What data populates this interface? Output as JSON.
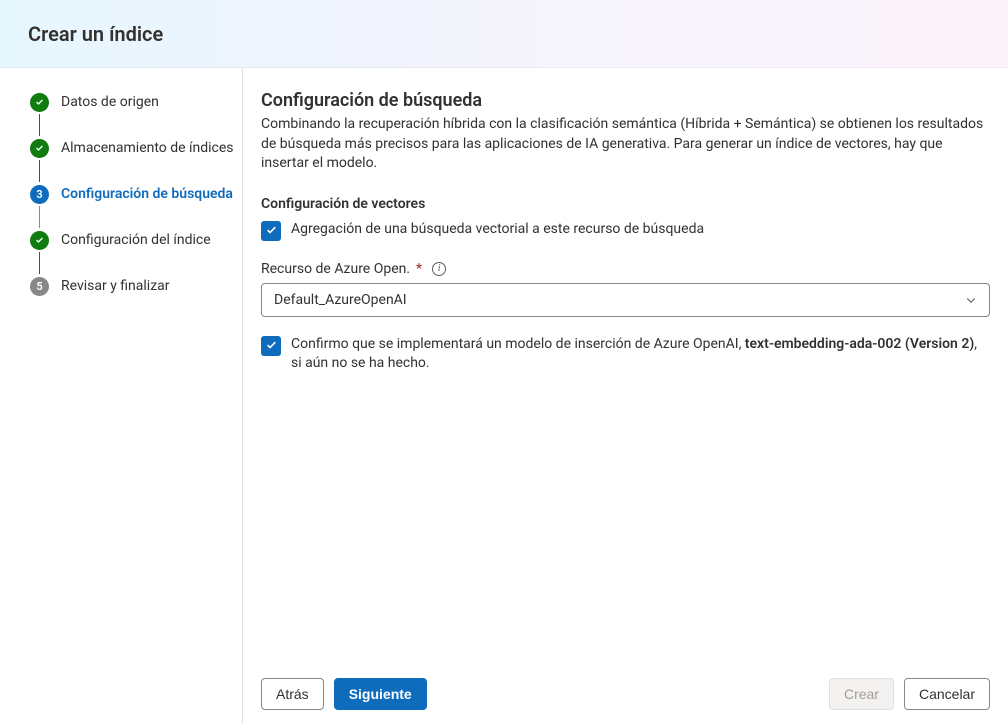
{
  "header": {
    "title": "Crear un índice"
  },
  "sidebar": {
    "steps": [
      {
        "label": "Datos de origen",
        "state": "done"
      },
      {
        "label": "Almacenamiento de índices",
        "state": "done"
      },
      {
        "label": "Configuración de búsqueda",
        "state": "active",
        "num": "3"
      },
      {
        "label": "Configuración del índice",
        "state": "done"
      },
      {
        "label": "Revisar y finalizar",
        "state": "pending",
        "num": "5"
      }
    ]
  },
  "main": {
    "title": "Configuración de búsqueda",
    "description": "Combinando la recuperación híbrida con la clasificación semántica (Híbrida + Semántica) se obtienen los resultados de búsqueda más precisos para las aplicaciones de IA generativa. Para generar un índice de vectores, hay que insertar el modelo.",
    "vector_section_title": "Configuración de vectores",
    "vector_checkbox_label": "Agregación de una búsqueda vectorial a este recurso de búsqueda",
    "resource_field_label": "Recurso de Azure Open.",
    "resource_dropdown_value": "Default_AzureOpenAI",
    "confirm_prefix": "Confirmo que se implementará un modelo de inserción de Azure OpenAI, ",
    "confirm_model_name": "text-embedding-ada-002 (Version 2)",
    "confirm_suffix": ", si aún no se ha hecho."
  },
  "footer": {
    "back": "Atrás",
    "next": "Siguiente",
    "create": "Crear",
    "cancel": "Cancelar"
  }
}
